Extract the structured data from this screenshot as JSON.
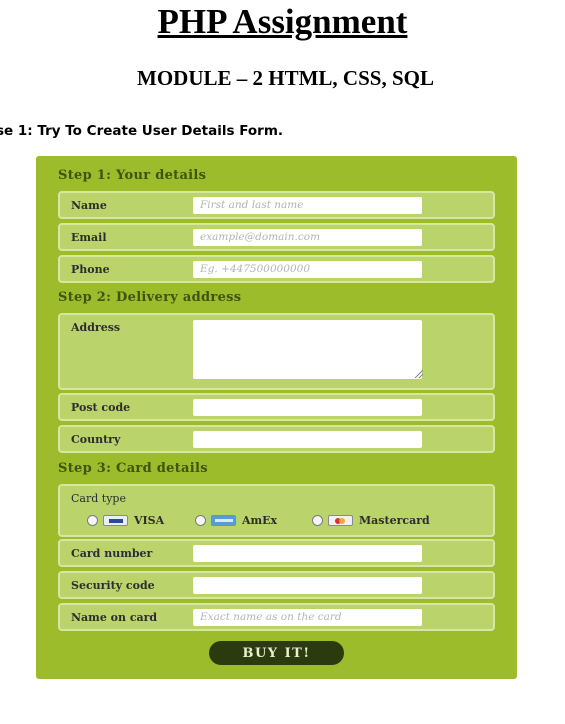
{
  "document": {
    "title": "PHP Assignment",
    "subtitle": "MODULE – 2 HTML, CSS, SQL",
    "exercise_heading": "se 1: Try To Create User Details Form."
  },
  "form": {
    "steps": [
      {
        "title": "Step 1: Your details",
        "fields": [
          {
            "label": "Name",
            "placeholder": "First and last name",
            "value": ""
          },
          {
            "label": "Email",
            "placeholder": "example@domain.com",
            "value": ""
          },
          {
            "label": "Phone",
            "placeholder": "Eg. +447500000000",
            "value": ""
          }
        ]
      },
      {
        "title": "Step 2: Delivery address",
        "fields": [
          {
            "label": "Address",
            "placeholder": "",
            "value": ""
          },
          {
            "label": "Post code",
            "placeholder": "",
            "value": ""
          },
          {
            "label": "Country",
            "placeholder": "",
            "value": ""
          }
        ]
      },
      {
        "title": "Step 3: Card details",
        "card_type": {
          "label": "Card type",
          "options": [
            {
              "name": "VISA",
              "icon": "visa-logo-icon"
            },
            {
              "name": "AmEx",
              "icon": "amex-logo-icon"
            },
            {
              "name": "Mastercard",
              "icon": "mastercard-logo-icon"
            }
          ]
        },
        "fields": [
          {
            "label": "Card number",
            "placeholder": "",
            "value": ""
          },
          {
            "label": "Security code",
            "placeholder": "",
            "value": ""
          },
          {
            "label": "Name on card",
            "placeholder": "Exact name as on the card",
            "value": ""
          }
        ]
      }
    ],
    "submit_label": "BUY IT!"
  },
  "colors": {
    "panel_background": "#9cbc2b",
    "row_background": "#bad46b",
    "row_border": "#d6e7a2",
    "section_title": "#3e5410",
    "button_background": "#2c3b0e",
    "button_text": "#e8efd2"
  }
}
